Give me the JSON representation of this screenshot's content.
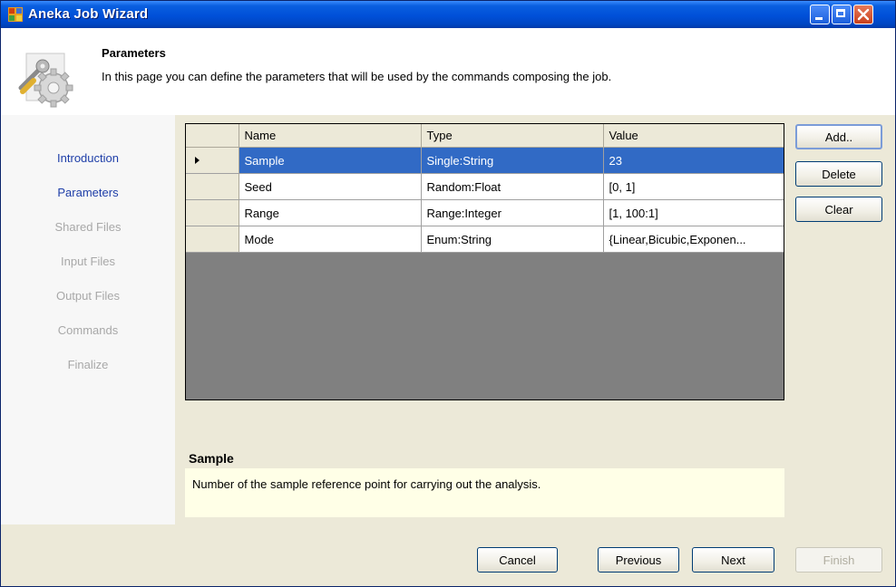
{
  "window": {
    "title": "Aneka Job Wizard",
    "controls": [
      "minimize-icon",
      "maximize-icon",
      "close-icon"
    ]
  },
  "header": {
    "title": "Parameters",
    "description": "In this page you can define the parameters that will be used  by the commands composing the job.",
    "icon": "settings-gear-icon"
  },
  "sidebar": {
    "items": [
      {
        "label": "Introduction",
        "state": "active"
      },
      {
        "label": "Parameters",
        "state": "active"
      },
      {
        "label": "Shared Files",
        "state": "disabled"
      },
      {
        "label": "Input Files",
        "state": "disabled"
      },
      {
        "label": "Output Files",
        "state": "disabled"
      },
      {
        "label": "Commands",
        "state": "disabled"
      },
      {
        "label": "Finalize",
        "state": "disabled"
      }
    ]
  },
  "grid": {
    "columns": [
      "Name",
      "Type",
      "Value"
    ],
    "rows": [
      {
        "name": "Sample",
        "type": "Single:String",
        "value": "23",
        "selected": true
      },
      {
        "name": "Seed",
        "type": "Random:Float",
        "value": "[0, 1]"
      },
      {
        "name": "Range",
        "type": "Range:Integer",
        "value": "[1, 100:1]"
      },
      {
        "name": "Mode",
        "type": "Enum:String",
        "value": "{Linear,Bicubic,Exponen..."
      }
    ]
  },
  "side_buttons": {
    "add": "Add..",
    "delete": "Delete",
    "clear": "Clear"
  },
  "help": {
    "title": "Sample",
    "text": "Number of the sample reference point for carrying out the analysis."
  },
  "footer": {
    "cancel": "Cancel",
    "previous": "Previous",
    "next": "Next",
    "finish": "Finish"
  },
  "colors": {
    "titlebar": "#0050d8",
    "selection": "#316ac5",
    "nav_active": "#1e3ea8",
    "nav_disabled": "#a8a8a8",
    "help_background": "#ffffe7",
    "grid_background": "#808080"
  }
}
